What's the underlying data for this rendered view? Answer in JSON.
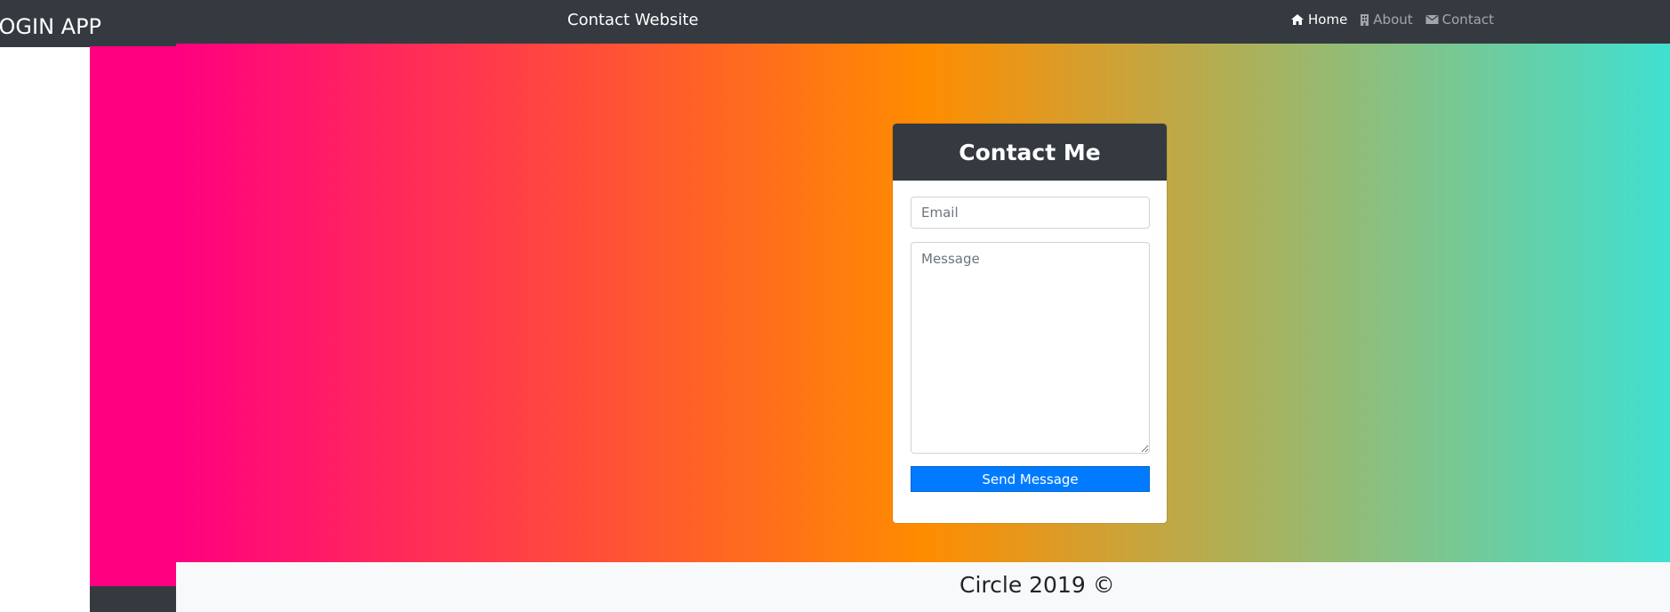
{
  "login_app": {
    "title": "LOGIN APP",
    "colors": {
      "bar": "#343a40",
      "pink": "#ff0080"
    }
  },
  "navbar": {
    "brand": "Contact Website",
    "links": [
      {
        "label": "Home",
        "icon": "home-icon",
        "active": true
      },
      {
        "label": "About",
        "icon": "building-icon",
        "active": false
      },
      {
        "label": "Contact",
        "icon": "envelope-icon",
        "active": false
      }
    ],
    "colors": {
      "background": "#343a40"
    }
  },
  "hero": {
    "gradient_colors": [
      "#ff0080",
      "#ff8c00",
      "#40e0d0"
    ]
  },
  "contact_card": {
    "title": "Contact Me",
    "email_placeholder": "Email",
    "email_value": "",
    "message_placeholder": "Message",
    "message_value": "",
    "send_label": "Send Message",
    "colors": {
      "header": "#343a40",
      "button": "#007bff"
    }
  },
  "footer": {
    "text": "Circle 2019 ©"
  }
}
